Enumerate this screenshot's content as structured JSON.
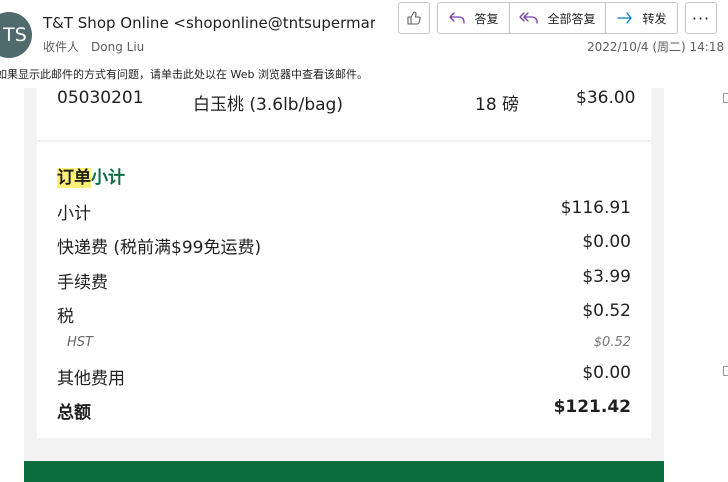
{
  "header": {
    "avatar_initials": "TS",
    "sender": "T&T Shop Online <shoponline@tntsupermarket.com>",
    "to_label": "收件人",
    "to_name": "Dong Liu",
    "date": "2022/10/4 (周二) 14:18"
  },
  "actions": {
    "like_icon": "thumbs-up-icon",
    "reply_label": "答复",
    "reply_all_label": "全部答复",
    "forward_label": "转发",
    "more_label": "···"
  },
  "notice": "如果显示此邮件的方式有问题，请单击此处以在 Web 浏览器中查看该邮件。",
  "item": {
    "code": "05030201",
    "name": "白玉桃 (3.6lb/bag)",
    "qty": "18 磅",
    "price": "$36.00"
  },
  "summary": {
    "title_highlight": "订单",
    "title_rest": "小计",
    "rows": [
      {
        "label": "小计",
        "value": "$116.91"
      },
      {
        "label": "快递费 (税前满$99免运费)",
        "value": "$0.00"
      },
      {
        "label": "手续费",
        "value": "$3.99"
      },
      {
        "label": "税",
        "value": "$0.52"
      }
    ],
    "hst_label": "HST",
    "hst_value": "$0.52",
    "other_label": "其他费用",
    "other_value": "$0.00",
    "total_label": "总额",
    "total_value": "$121.42"
  },
  "colors": {
    "brand_green": "#0a6d3e",
    "highlight": "#fff176",
    "avatar_bg": "#4f6b6e"
  }
}
